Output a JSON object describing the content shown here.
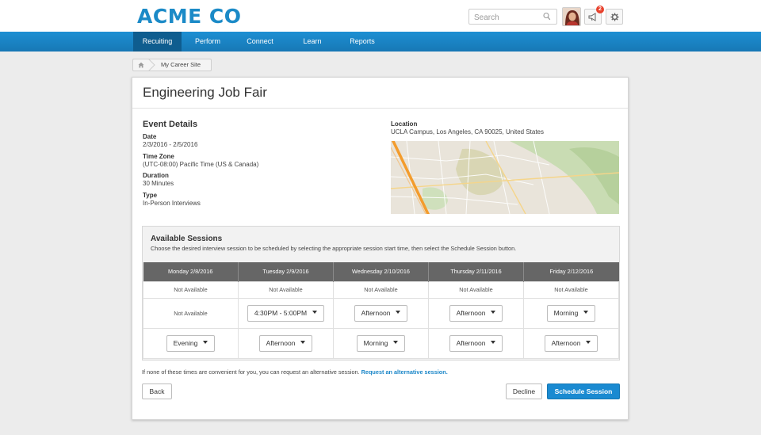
{
  "header": {
    "logo": "ACME CO",
    "search_placeholder": "Search",
    "notification_count": "2",
    "icons": [
      "search-icon",
      "megaphone-icon",
      "gear-icon"
    ]
  },
  "nav": {
    "items": [
      {
        "label": "Recuiting",
        "active": true
      },
      {
        "label": "Perform",
        "active": false
      },
      {
        "label": "Connect",
        "active": false
      },
      {
        "label": "Learn",
        "active": false
      },
      {
        "label": "Reports",
        "active": false
      }
    ]
  },
  "breadcrumb": {
    "label": "My Career Site"
  },
  "event": {
    "title": "Engineering Job Fair",
    "details_heading": "Event Details",
    "date_label": "Date",
    "date_value": "2/3/2016 - 2/5/2016",
    "timezone_label": "Time Zone",
    "timezone_value": "(UTC-08:00) Pacific Time (US & Canada)",
    "duration_label": "Duration",
    "duration_value": "30 Minutes",
    "type_label": "Type",
    "type_value": "In-Person Interviews",
    "location_label": "Location",
    "location_value": "UCLA Campus, Los Angeles, CA 90025, United States"
  },
  "sessions": {
    "title": "Available Sessions",
    "description": "Choose the desired interview session to be scheduled by selecting the appropriate session start time, then select the Schedule Session button.",
    "columns": [
      "Monday 2/8/2016",
      "Tuesday 2/9/2016",
      "Wednesday 2/10/2016",
      "Thursday 2/11/2016",
      "Friday 2/12/2016"
    ],
    "row1": [
      "Not Available",
      "Not Available",
      "Not Available",
      "Not Available",
      "Not Available"
    ],
    "row2": [
      "Not Available",
      "4:30PM - 5:00PM",
      "Afternoon",
      "Afternoon",
      "Morning"
    ],
    "row3": [
      "Evening",
      "Afternoon",
      "Morning",
      "Afternoon",
      "Afternoon"
    ]
  },
  "footer": {
    "alt_text": "If none of these times are convenient for you, you can request an alternative session.",
    "alt_link": "Request an alternative session.",
    "back_label": "Back",
    "decline_label": "Decline",
    "schedule_label": "Schedule Session"
  },
  "colors": {
    "brand": "#1b8ac7",
    "nav": "#1a86c8",
    "nav_active": "#0f5d8f",
    "table_header": "#666666",
    "primary_button": "#1a8ad1"
  }
}
